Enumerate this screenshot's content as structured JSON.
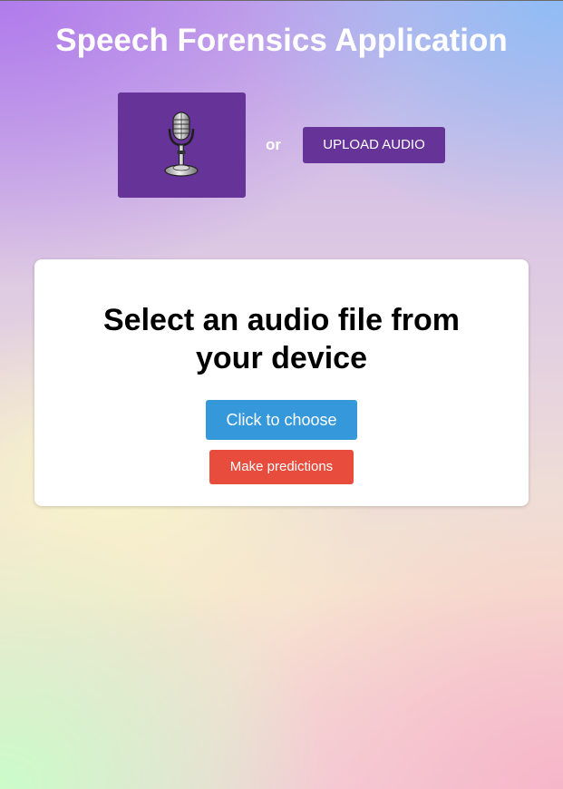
{
  "header": {
    "title": "Speech Forensics Application"
  },
  "record": {
    "icon": "microphone-icon",
    "separator": "or",
    "upload_label": "UPLOAD AUDIO"
  },
  "card": {
    "heading": "Select an audio file from your device",
    "choose_label": "Click to choose",
    "predict_label": "Make predictions"
  },
  "colors": {
    "primary_purple": "#663399",
    "choose_blue": "#3498db",
    "predict_red": "#e74c3c"
  }
}
